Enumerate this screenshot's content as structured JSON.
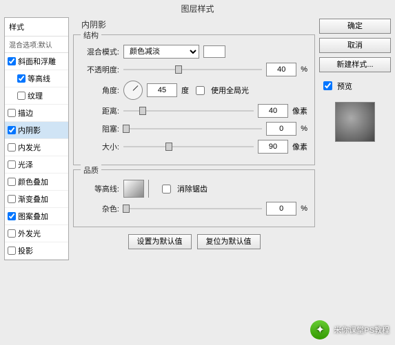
{
  "title": "图层样式",
  "sidebar": {
    "header": "样式",
    "blend": "混合选项:默认",
    "items": [
      {
        "label": "斜面和浮雕",
        "checked": true,
        "sub": false
      },
      {
        "label": "等高线",
        "checked": true,
        "sub": true
      },
      {
        "label": "纹理",
        "checked": false,
        "sub": true
      },
      {
        "label": "描边",
        "checked": false,
        "sub": false
      },
      {
        "label": "内阴影",
        "checked": true,
        "sub": false,
        "selected": true
      },
      {
        "label": "内发光",
        "checked": false,
        "sub": false
      },
      {
        "label": "光泽",
        "checked": false,
        "sub": false
      },
      {
        "label": "颜色叠加",
        "checked": false,
        "sub": false
      },
      {
        "label": "渐变叠加",
        "checked": false,
        "sub": false
      },
      {
        "label": "图案叠加",
        "checked": true,
        "sub": false
      },
      {
        "label": "外发光",
        "checked": false,
        "sub": false
      },
      {
        "label": "投影",
        "checked": false,
        "sub": false
      }
    ]
  },
  "panel": {
    "header": "内阴影",
    "structure": {
      "legend": "结构",
      "blendmode_label": "混合模式:",
      "blendmode_value": "颜色减淡",
      "opacity_label": "不透明度:",
      "opacity_value": "40",
      "opacity_unit": "%",
      "angle_label": "角度:",
      "angle_value": "45",
      "angle_unit": "度",
      "global_label": "使用全局光",
      "distance_label": "距离:",
      "distance_value": "40",
      "distance_unit": "像素",
      "choke_label": "阻塞:",
      "choke_value": "0",
      "choke_unit": "%",
      "size_label": "大小:",
      "size_value": "90",
      "size_unit": "像素"
    },
    "quality": {
      "legend": "品质",
      "contour_label": "等高线:",
      "antialias_label": "消除锯齿",
      "noise_label": "杂色:",
      "noise_value": "0",
      "noise_unit": "%"
    },
    "defaults": {
      "set": "设置为默认值",
      "reset": "复位为默认值"
    }
  },
  "right": {
    "ok": "确定",
    "cancel": "取消",
    "newstyle": "新建样式...",
    "preview": "预览"
  },
  "watermark": "米你课堂PS教程"
}
